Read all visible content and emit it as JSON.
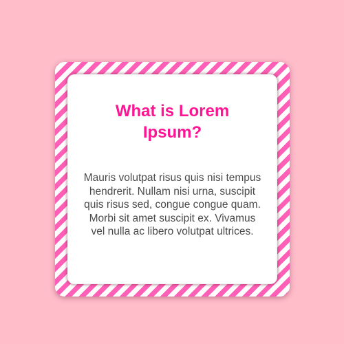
{
  "card": {
    "title": "What is Lorem Ipsum?",
    "body": "Mauris volutpat risus quis nisi tempus hendrerit. Nullam nisi urna, suscipit quis risus sed, congue congue quam. Morbi sit amet suscipit ex. Vivamus vel nulla ac libero volutpat ultrices."
  },
  "colors": {
    "background": "#ffbcc9",
    "stripe_pink": "#ff5fb6",
    "stripe_white": "#ffffff",
    "title": "#ff1493",
    "body_text": "#4a4a4a",
    "card": "#ffffff"
  }
}
